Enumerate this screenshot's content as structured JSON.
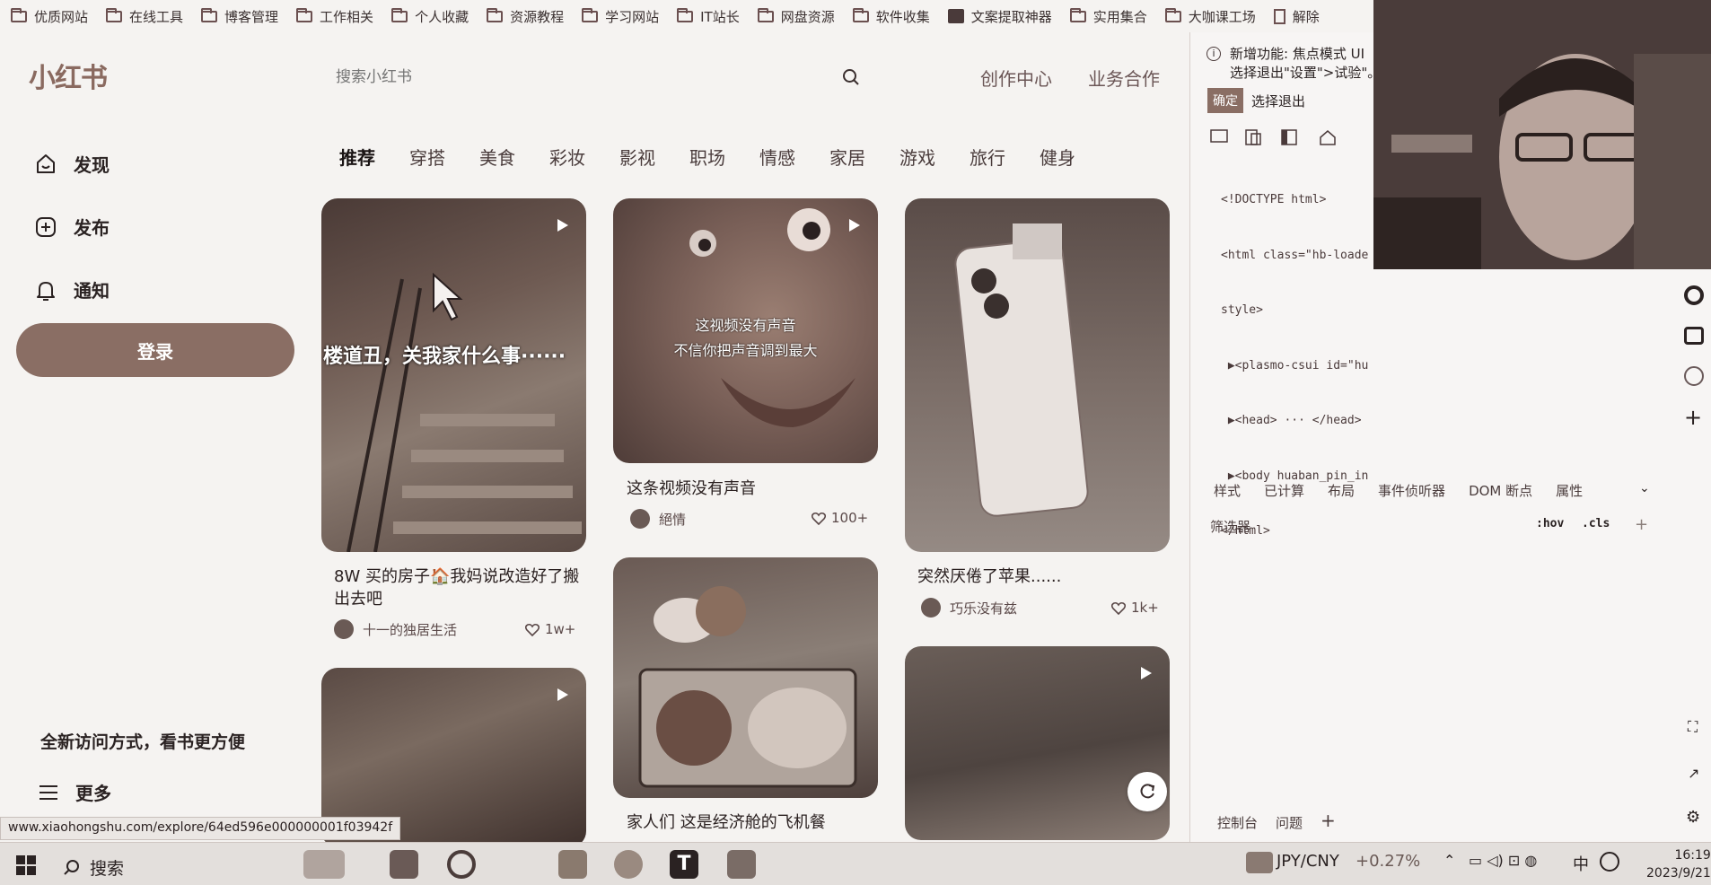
{
  "bookmarks": [
    "优质网站",
    "在线工具",
    "博客管理",
    "工作相关",
    "个人收藏",
    "资源教程",
    "学习网站",
    "IT站长",
    "网盘资源",
    "软件收集",
    "文案提取神器",
    "实用集合",
    "大咖课工场",
    "解除"
  ],
  "header": {
    "logo": "小红书",
    "search_placeholder": "搜索小红书",
    "creator_center": "创作中心",
    "business": "业务合作"
  },
  "sidebar": {
    "items": [
      {
        "label": "发现",
        "icon": "home-icon"
      },
      {
        "label": "发布",
        "icon": "plus-icon"
      },
      {
        "label": "通知",
        "icon": "bell-icon"
      }
    ],
    "login_label": "登录",
    "promo_text": "全新访问方式，看书更方便",
    "more_label": "更多"
  },
  "tabs": [
    "推荐",
    "穿搭",
    "美食",
    "彩妆",
    "影视",
    "职场",
    "情感",
    "家居",
    "游戏",
    "旅行",
    "健身"
  ],
  "feed": [
    {
      "overlay": "楼道丑，关我家什么事······",
      "title": "8W 买的房子🏠我妈说改造好了搬出去吧",
      "author": "十一的独居生活",
      "likes": "1w+"
    },
    {
      "overlay1": "这视频没有声音",
      "overlay2": "不信你把声音调到最大",
      "title": "这条视频没有声音",
      "author": "絕情",
      "likes": "100+"
    },
    {
      "title": "突然厌倦了苹果......",
      "author": "巧乐没有兹",
      "likes": "1k+"
    },
    {
      "title": "家人们 这是经济舱的飞机餐"
    }
  ],
  "status_url": "www.xiaohongshu.com/explore/64ed596e000000001f03942f",
  "devtools": {
    "notice_line1": "新增功能: 焦点模式 UI",
    "notice_line2": "选择退出\"设置\">试验\"。",
    "ok": "确定",
    "quit": "选择退出",
    "tree": [
      "<!DOCTYPE html>",
      "<html class=\"hb-loade",
      "style>",
      " ▶<plasmo-csui id=\"hu",
      " ▶<head> ··· </head>",
      " ▶<body huaban_pin_in",
      "</html>"
    ],
    "panel_tabs": [
      "样式",
      "已计算",
      "布局",
      "事件侦听器",
      "DOM 断点",
      "属性"
    ],
    "filter": "筛选器",
    "hov": ":hov",
    "cls": ".cls",
    "bottom_tabs": [
      "控制台",
      "问题"
    ]
  },
  "taskbar": {
    "search": "搜索",
    "currency": "JPY/CNY",
    "change": "+0.27%",
    "ime": "中",
    "time": "16:19",
    "date": "2023/9/21"
  },
  "colors": {
    "accent": "#8a6e64",
    "background": "#f5f3f1"
  }
}
